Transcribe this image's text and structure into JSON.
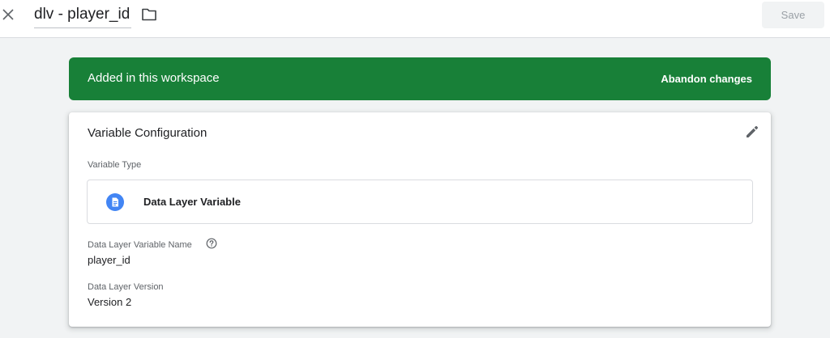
{
  "header": {
    "title": "dlv - player_id",
    "save_label": "Save",
    "close_icon": "close-icon",
    "folder_icon": "folder-icon"
  },
  "banner": {
    "text": "Added in this workspace",
    "action_label": "Abandon changes",
    "color": "#188038"
  },
  "config": {
    "title": "Variable Configuration",
    "edit_icon": "pencil-icon",
    "type_label": "Variable Type",
    "type_name": "Data Layer Variable",
    "type_icon": "document-icon",
    "name_label": "Data Layer Variable Name",
    "name_help_icon": "help-circle-icon",
    "name_value": "player_id",
    "version_label": "Data Layer Version",
    "version_value": "Version 2"
  },
  "colors": {
    "accent_blue": "#4285f4",
    "banner_green": "#188038",
    "background": "#f1f3f4"
  }
}
